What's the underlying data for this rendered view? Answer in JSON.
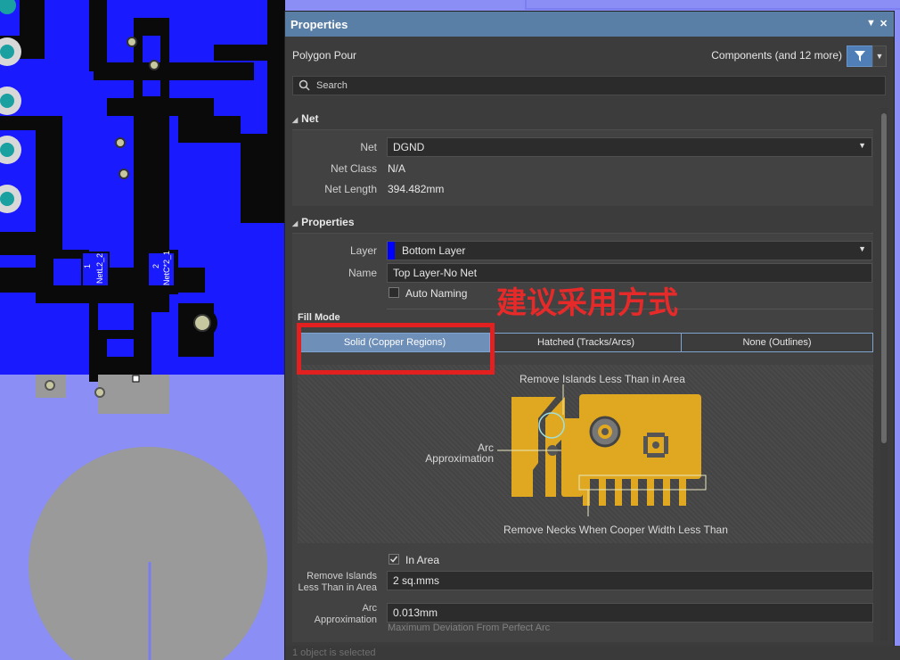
{
  "panel": {
    "title": "Properties",
    "object_type": "Polygon Pour",
    "filter_summary": "Components (and 12 more)",
    "search_placeholder": "Search",
    "status": "1 object is selected"
  },
  "net_section": {
    "header": "Net",
    "net_label": "Net",
    "net_value": "DGND",
    "net_class_label": "Net Class",
    "net_class_value": "N/A",
    "net_length_label": "Net Length",
    "net_length_value": "394.482mm"
  },
  "properties_section": {
    "header": "Properties",
    "layer_label": "Layer",
    "layer_value": "Bottom Layer",
    "layer_color": "#0000ff",
    "name_label": "Name",
    "name_value": "Top Layer-No Net",
    "auto_naming_label": "Auto Naming",
    "fill_mode_label": "Fill Mode",
    "fill_modes": [
      "Solid (Copper Regions)",
      "Hatched (Tracks/Arcs)",
      "None (Outlines)"
    ],
    "selected_fill_mode": "Solid (Copper Regions)"
  },
  "diagram": {
    "remove_islands": "Remove Islands Less Than in Area",
    "arc_approx_line1": "Arc",
    "arc_approx_line2": "Approximation",
    "remove_necks": "Remove Necks When Cooper Width Less Than",
    "copper_color": "#e0a820"
  },
  "settings": {
    "in_area_label": "In Area",
    "in_area_checked": true,
    "remove_islands_label_1": "Remove Islands",
    "remove_islands_label_2": "Less Than in Area",
    "remove_islands_value": "2 sq.mms",
    "arc_label_1": "Arc",
    "arc_label_2": "Approximation",
    "arc_value": "0.013mm",
    "arc_hint": "Maximum Deviation From Perfect Arc"
  },
  "annotation": {
    "text": "建议采用方式",
    "color": "#e32020"
  },
  "pcb": {
    "label_1": "1",
    "label_2": "NetL2_2",
    "label_3": "2",
    "label_4": "NetC*2_1",
    "copper_color": "#1a1aff",
    "bg_color": "#8a8ef5"
  },
  "colors": {
    "accent": "#5a7fa6",
    "filter_button": "#4f7fb6"
  }
}
